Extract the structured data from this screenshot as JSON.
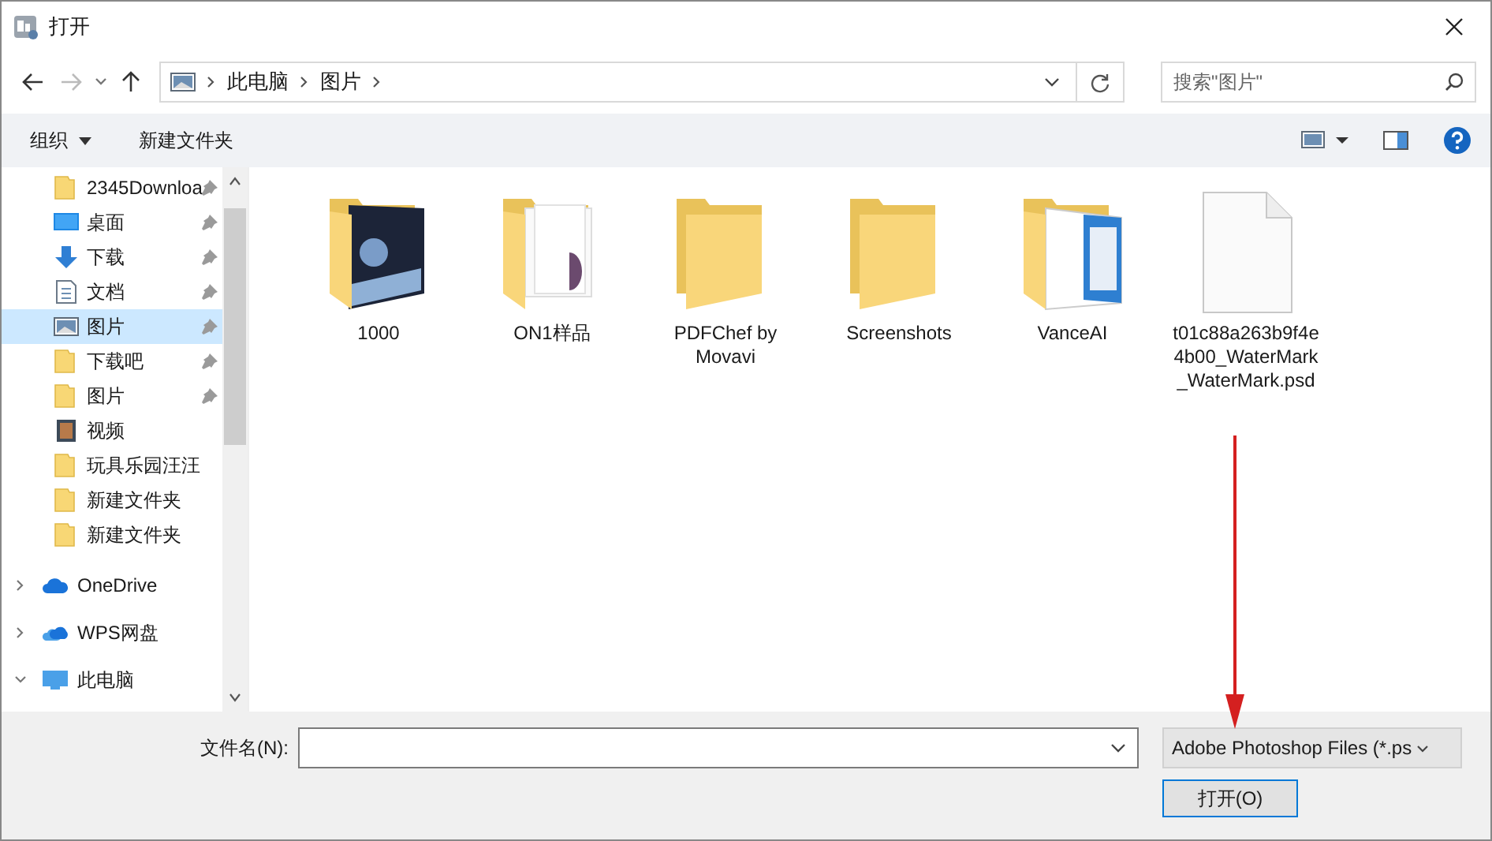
{
  "window": {
    "title": "打开"
  },
  "breadcrumb": [
    "此电脑",
    "图片"
  ],
  "search": {
    "placeholder": "搜索\"图片\""
  },
  "toolbar": {
    "buttons": [
      {
        "label": "组织",
        "dropdown": true
      },
      {
        "label": "新建文件夹",
        "dropdown": false
      }
    ]
  },
  "sidebar": {
    "quick_access": [
      {
        "label": "2345Downloa",
        "kind": "folder",
        "pinned": true,
        "selected": false
      },
      {
        "label": "桌面",
        "kind": "desktop",
        "pinned": true,
        "selected": false
      },
      {
        "label": "下载",
        "kind": "download",
        "pinned": true,
        "selected": false
      },
      {
        "label": "文档",
        "kind": "document",
        "pinned": true,
        "selected": false
      },
      {
        "label": "图片",
        "kind": "pictures",
        "pinned": true,
        "selected": true
      },
      {
        "label": "下载吧",
        "kind": "folder",
        "pinned": true,
        "selected": false
      },
      {
        "label": "图片",
        "kind": "folder",
        "pinned": true,
        "selected": false
      },
      {
        "label": "视频",
        "kind": "video",
        "pinned": false,
        "selected": false
      },
      {
        "label": "玩具乐园汪汪",
        "kind": "folder",
        "pinned": false,
        "selected": false
      },
      {
        "label": "新建文件夹",
        "kind": "folder",
        "pinned": false,
        "selected": false
      },
      {
        "label": "新建文件夹",
        "kind": "folder",
        "pinned": false,
        "selected": false
      }
    ],
    "locations": [
      {
        "label": "OneDrive",
        "kind": "cloud",
        "expanded": false
      },
      {
        "label": "WPS网盘",
        "kind": "cloud-pair",
        "expanded": false
      },
      {
        "label": "此电脑",
        "kind": "pc",
        "expanded": true
      }
    ]
  },
  "files": [
    {
      "name": "1000",
      "kind": "folder-photo"
    },
    {
      "name": "ON1样品",
      "kind": "folder-doc"
    },
    {
      "name": "PDFChef by Movavi",
      "kind": "folder"
    },
    {
      "name": "Screenshots",
      "kind": "folder"
    },
    {
      "name": "VanceAI",
      "kind": "folder-window"
    },
    {
      "name": "t01c88a263b9f4e4b00_WaterMark_WaterMark.psd",
      "kind": "file"
    }
  ],
  "footer": {
    "filename_label": "文件名(N):",
    "filter": "Adobe Photoshop Files (*.ps",
    "open_button": "打开(O)"
  },
  "annotations": [
    {
      "kind": "arrow"
    }
  ]
}
